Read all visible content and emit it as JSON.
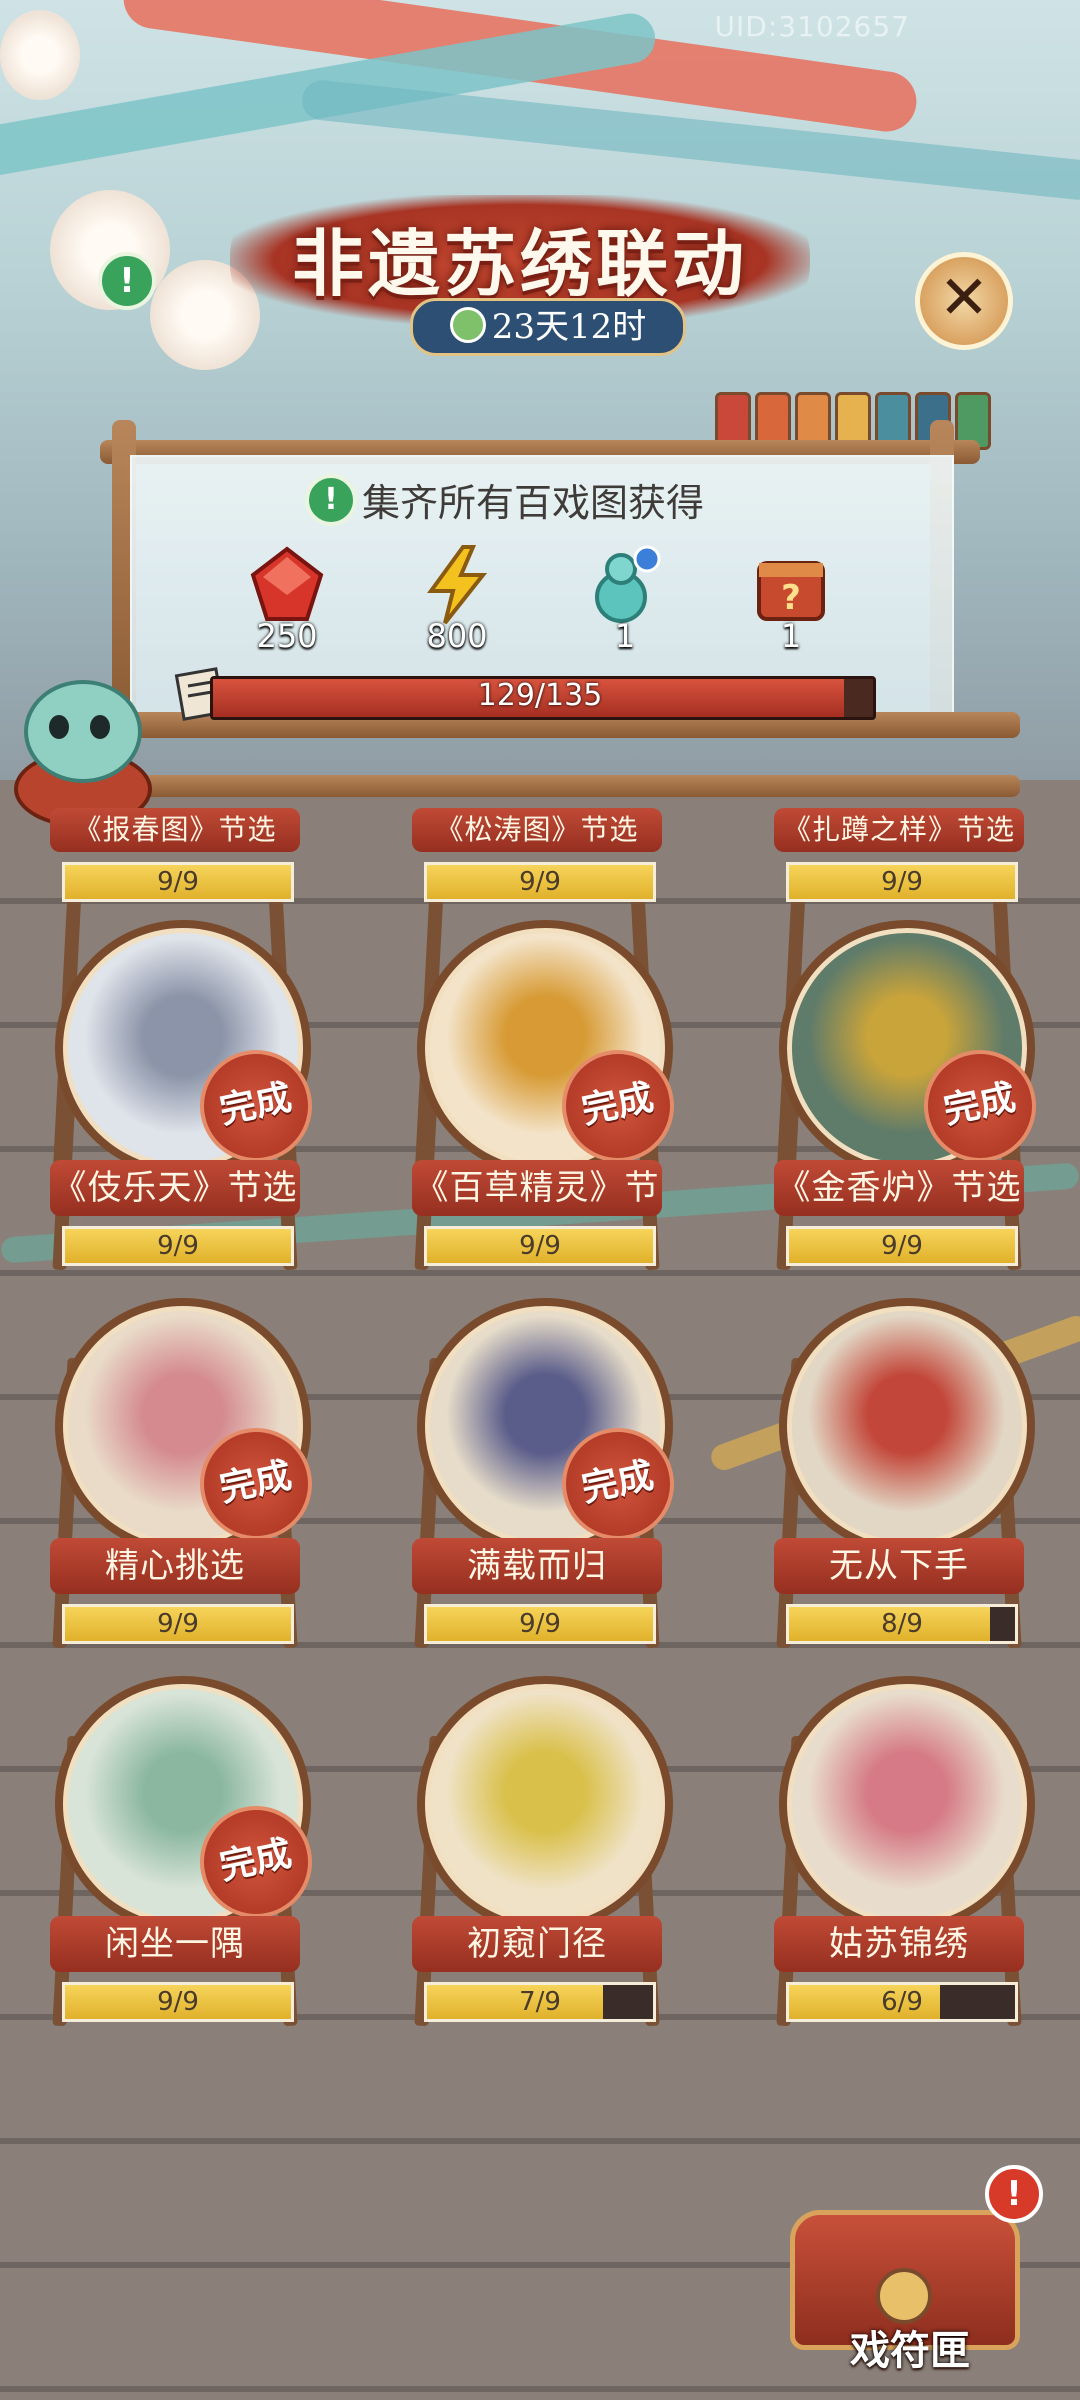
{
  "header": {
    "uid": "UID:3102657",
    "title": "非遗苏绣联动",
    "timer": "23天12时"
  },
  "collection": {
    "subtitle": "集齐所有百戏图获得",
    "rewards": [
      {
        "icon": "red-gem-icon",
        "amount": "250"
      },
      {
        "icon": "lightning-icon",
        "amount": "800"
      },
      {
        "icon": "teal-gourd-icon",
        "amount": "1"
      },
      {
        "icon": "mystery-box-icon",
        "amount": "1"
      }
    ],
    "progress_text": "129/135",
    "progress_value": 129,
    "progress_max": 135
  },
  "cards_top_row": [
    {
      "label": "《报春图》节选",
      "progress": "9/9",
      "fill": 1.0
    },
    {
      "label": "《松涛图》节选",
      "progress": "9/9",
      "fill": 1.0
    },
    {
      "label": "《扎蹲之样》节选",
      "progress": "9/9",
      "fill": 1.0
    }
  ],
  "cards": [
    {
      "label": "《伎乐天》节选",
      "progress": "9/9",
      "fill": 1.0,
      "complete": true,
      "badge": "完成"
    },
    {
      "label": "《百草精灵》节选",
      "progress": "9/9",
      "fill": 1.0,
      "complete": true,
      "badge": "完成"
    },
    {
      "label": "《金香炉》节选",
      "progress": "9/9",
      "fill": 1.0,
      "complete": true,
      "badge": "完成"
    },
    {
      "label": "精心挑选",
      "progress": "9/9",
      "fill": 1.0,
      "complete": true,
      "badge": "完成"
    },
    {
      "label": "满载而归",
      "progress": "9/9",
      "fill": 1.0,
      "complete": true,
      "badge": "完成"
    },
    {
      "label": "无从下手",
      "progress": "8/9",
      "fill": 0.889,
      "complete": false,
      "badge": ""
    },
    {
      "label": "闲坐一隅",
      "progress": "9/9",
      "fill": 1.0,
      "complete": true,
      "badge": "完成"
    },
    {
      "label": "初窥门径",
      "progress": "7/9",
      "fill": 0.778,
      "complete": false,
      "badge": ""
    },
    {
      "label": "姑苏锦绣",
      "progress": "6/9",
      "fill": 0.667,
      "complete": false,
      "badge": ""
    }
  ],
  "chest": {
    "label": "戏符匣",
    "alert": "!"
  },
  "colors": {
    "accent_red": "#a8321f",
    "progress_yellow": "#f6d45a",
    "info_green": "#3aa35b",
    "timer_blue": "#2d4f73"
  }
}
